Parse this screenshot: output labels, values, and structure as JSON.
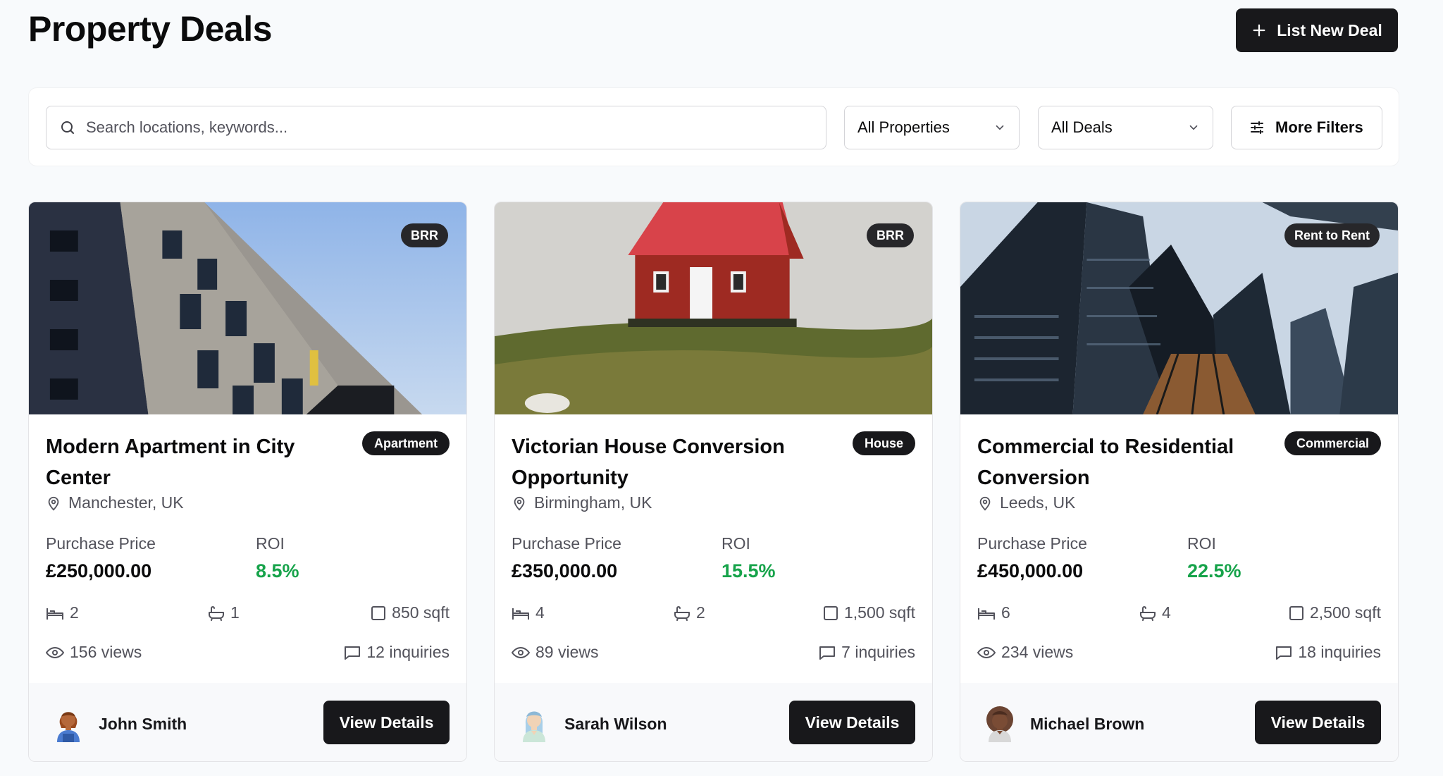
{
  "header": {
    "title": "Property Deals",
    "new_deal_label": "List New Deal"
  },
  "filters": {
    "search_placeholder": "Search locations, keywords...",
    "property_select": "All Properties",
    "deal_select": "All Deals",
    "more_filters_label": "More Filters"
  },
  "colors": {
    "roi": "#16a34a",
    "primary": "#18181b"
  },
  "cards": [
    {
      "deal_badge": "BRR",
      "type_badge": "Apartment",
      "title": "Modern Apartment in City Center",
      "location": "Manchester, UK",
      "price_label": "Purchase Price",
      "price": "£250,000.00",
      "roi_label": "ROI",
      "roi": "8.5%",
      "beds": "2",
      "baths": "1",
      "area": "850 sqft",
      "views": "156 views",
      "inquiries": "12 inquiries",
      "agent": "John Smith",
      "button_label": "View Details",
      "image": "apartment-building-photo"
    },
    {
      "deal_badge": "BRR",
      "type_badge": "House",
      "title": "Victorian House Conversion Opportunity",
      "location": "Birmingham, UK",
      "price_label": "Purchase Price",
      "price": "£350,000.00",
      "roi_label": "ROI",
      "roi": "15.5%",
      "beds": "4",
      "baths": "2",
      "area": "1,500 sqft",
      "views": "89 views",
      "inquiries": "7 inquiries",
      "agent": "Sarah Wilson",
      "button_label": "View Details",
      "image": "red-house-on-hill-photo"
    },
    {
      "deal_badge": "Rent to Rent",
      "type_badge": "Commercial",
      "title": "Commercial to Residential Conversion",
      "location": "Leeds, UK",
      "price_label": "Purchase Price",
      "price": "£450,000.00",
      "roi_label": "ROI",
      "roi": "22.5%",
      "beds": "6",
      "baths": "4",
      "area": "2,500 sqft",
      "views": "234 views",
      "inquiries": "18 inquiries",
      "agent": "Michael Brown",
      "button_label": "View Details",
      "image": "glass-skyscrapers-photo"
    }
  ]
}
